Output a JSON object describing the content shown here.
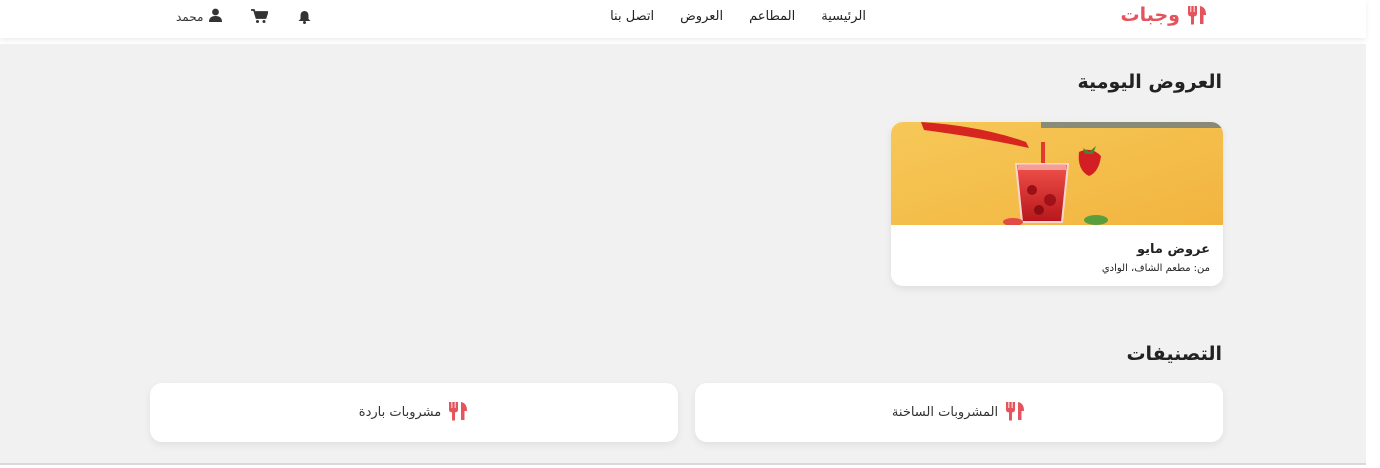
{
  "brand": {
    "name": "وجبات",
    "color": "#e3545c"
  },
  "nav": [
    {
      "label": "الرئيسية"
    },
    {
      "label": "المطاعم"
    },
    {
      "label": "العروض"
    },
    {
      "label": "اتصل بنا"
    }
  ],
  "toolbar": {
    "user_name": "محمد",
    "icons": [
      "user-icon",
      "cart-icon",
      "bell-icon"
    ]
  },
  "offers": {
    "title": "العروض اليومية",
    "items": [
      {
        "name": "عروض مايو",
        "from_label": "من:",
        "from_value": "مطعم الشاف، الوادي",
        "image": "strawberry-juice-image"
      }
    ]
  },
  "categories": {
    "title": "التصنيفات",
    "items": [
      {
        "label": "المشروبات الساخنة",
        "icon": "utensils-icon"
      },
      {
        "label": "مشروبات باردة",
        "icon": "utensils-icon"
      }
    ]
  },
  "colors": {
    "accent": "#e3545c",
    "background": "#f1f1f1",
    "card": "#ffffff"
  }
}
